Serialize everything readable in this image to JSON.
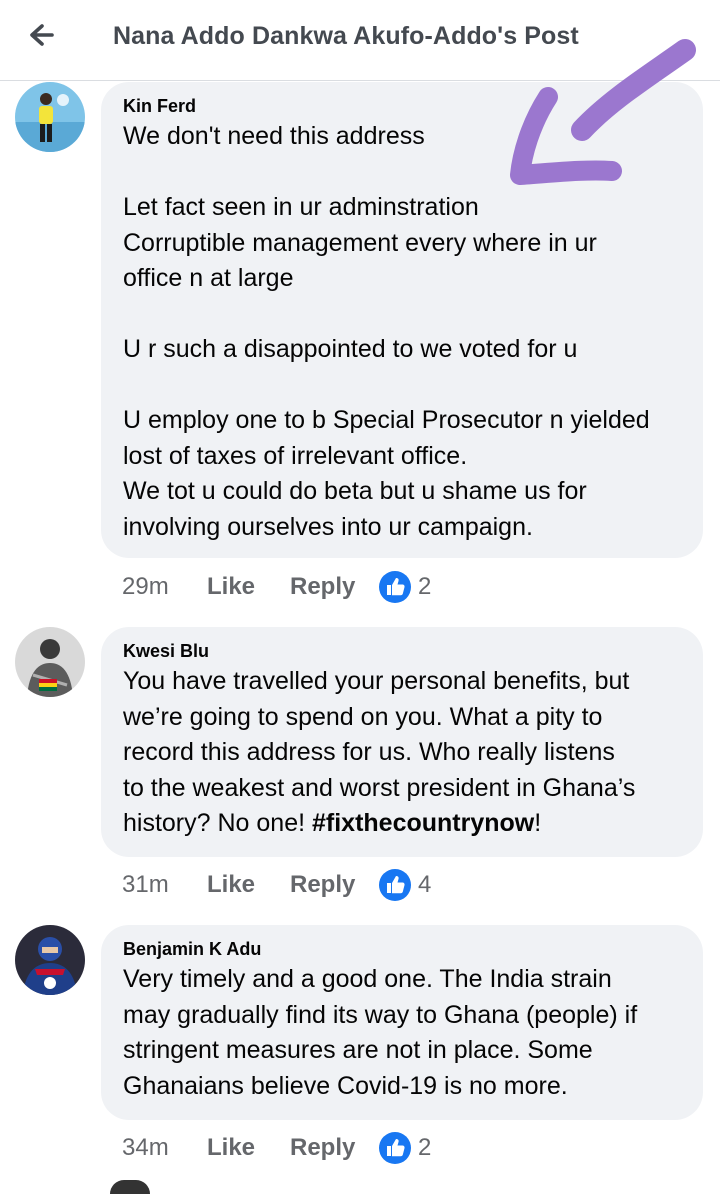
{
  "header": {
    "title": "Nana Addo Dankwa Akufo-Addo's Post",
    "back_icon": "back-arrow-icon"
  },
  "colors": {
    "bubble_bg": "#f0f2f5",
    "meta_text": "#65676b",
    "like_blue": "#1877f2",
    "annotation_purple": "#9b77cf"
  },
  "comments": [
    {
      "author": "Kin Ferd",
      "paragraphs": [
        [
          "We don't need this address"
        ],
        [
          "Let fact seen in ur adminstration",
          "Corruptible management every where in ur",
          "office n at large"
        ],
        [
          "U r such a disappointed to we voted for u"
        ],
        [
          "U employ one to b Special Prosecutor n yielded",
          "lost of taxes of irrelevant office.",
          "We tot u could do beta but u shame us for",
          "involving ourselves into ur campaign."
        ]
      ],
      "time": "29m",
      "like_label": "Like",
      "reply_label": "Reply",
      "reaction_icon": "like-reaction-icon",
      "reaction_count": "2"
    },
    {
      "author": "Kwesi Blu",
      "lines": [
        "You have travelled your personal benefits, but",
        "we’re going to spend on you. What a pity to",
        "record this address for us. Who really listens",
        "to the weakest and worst president in Ghana’s",
        "history? No one! "
      ],
      "hashtag": "#fixthecountrynow",
      "trailing": "!",
      "time": "31m",
      "like_label": "Like",
      "reply_label": "Reply",
      "reaction_icon": "like-reaction-icon",
      "reaction_count": "4"
    },
    {
      "author": "Benjamin K Adu",
      "lines": [
        "Very timely and a good one. The India strain",
        "may gradually find its way to Ghana (people) if",
        "stringent measures are not in place. Some",
        "Ghanaians believe Covid-19 is no more."
      ],
      "time": "34m",
      "like_label": "Like",
      "reply_label": "Reply",
      "reaction_icon": "like-reaction-icon",
      "reaction_count": "2"
    }
  ]
}
